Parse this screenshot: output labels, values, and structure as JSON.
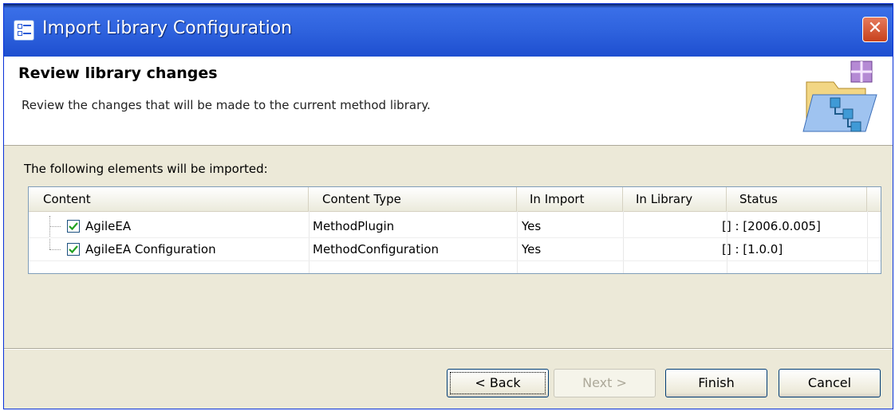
{
  "window": {
    "title": "Import Library Configuration",
    "close_glyph": "✕"
  },
  "header": {
    "heading": "Review library changes",
    "description": "Review the changes that will be made to the current method library."
  },
  "main": {
    "label": "The following elements will be imported:",
    "columns": [
      "Content",
      "Content Type",
      "In Import",
      "In Library",
      "Status"
    ],
    "rows": [
      {
        "content": "AgileEA",
        "type": "MethodPlugin",
        "in_import": "Yes",
        "in_library": "",
        "status": "[] : [2006.0.005]",
        "checked": true
      },
      {
        "content": "AgileEA Configuration",
        "type": "MethodConfiguration",
        "in_import": "Yes",
        "in_library": "",
        "status": "[] : [1.0.0]",
        "checked": true
      }
    ]
  },
  "buttons": {
    "back": "< Back",
    "next": "Next >",
    "finish": "Finish",
    "cancel": "Cancel"
  },
  "colors": {
    "titlebar": "#2f63de",
    "dialog_bg": "#ece9d8",
    "close": "#c8421c"
  },
  "icons": {
    "app": "wizard-app-icon",
    "banner": "library-import-icon",
    "check": "checkmark-icon"
  }
}
